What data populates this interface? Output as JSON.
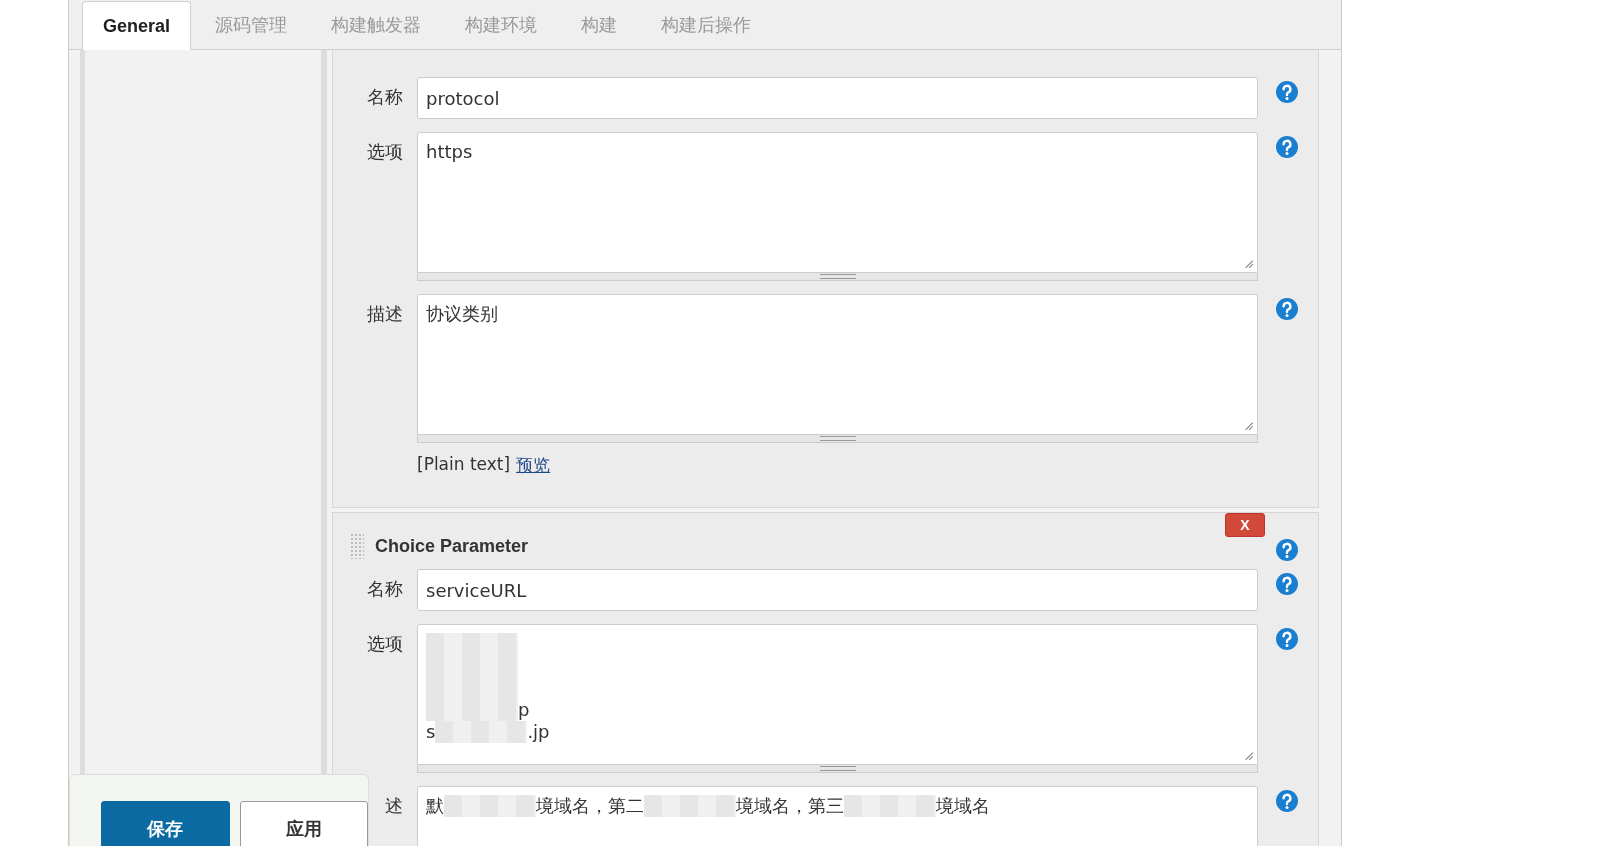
{
  "tabs": [
    {
      "label": "General",
      "selected": true
    },
    {
      "label": "源码管理",
      "selected": false
    },
    {
      "label": "构建触发器",
      "selected": false
    },
    {
      "label": "构建环境",
      "selected": false
    },
    {
      "label": "构建",
      "selected": false
    },
    {
      "label": "构建后操作",
      "selected": false
    }
  ],
  "parameters": [
    {
      "fields": [
        {
          "label": "名称",
          "kind": "input",
          "value": "protocol"
        },
        {
          "label": "选项",
          "kind": "textarea",
          "lines": [
            [
              {
                "text": "https"
              }
            ]
          ]
        },
        {
          "label": "描述",
          "kind": "textarea",
          "lines": [
            [
              {
                "text": "协议类别"
              }
            ]
          ]
        }
      ],
      "format_note": "[Plain text]",
      "preview_link": "预览"
    },
    {
      "title": "Choice Parameter",
      "delete_button": "X",
      "fields": [
        {
          "label": "名称",
          "kind": "input",
          "value": "serviceURL"
        },
        {
          "label": "选项",
          "kind": "textarea",
          "lines": [
            [
              {
                "kind": "redacted"
              }
            ],
            [
              {
                "kind": "redacted"
              }
            ],
            [
              {
                "kind": "redacted"
              }
            ],
            [
              {
                "kind": "redacted"
              },
              {
                "text": "p"
              }
            ],
            [
              {
                "text": "s"
              },
              {
                "kind": "redacted"
              },
              {
                "text": ".jp"
              }
            ]
          ]
        },
        {
          "label": "述",
          "kind": "textarea",
          "lines": [
            [
              {
                "text": "默"
              },
              {
                "kind": "redacted"
              },
              {
                "text": "境域名，第二"
              },
              {
                "kind": "redacted"
              },
              {
                "text": "境域名，第三"
              },
              {
                "kind": "redacted"
              },
              {
                "text": "境域名"
              }
            ]
          ]
        }
      ]
    }
  ],
  "buttons": [
    {
      "label": "保存",
      "kind": "primary"
    },
    {
      "label": "应用",
      "kind": "secondary"
    }
  ]
}
